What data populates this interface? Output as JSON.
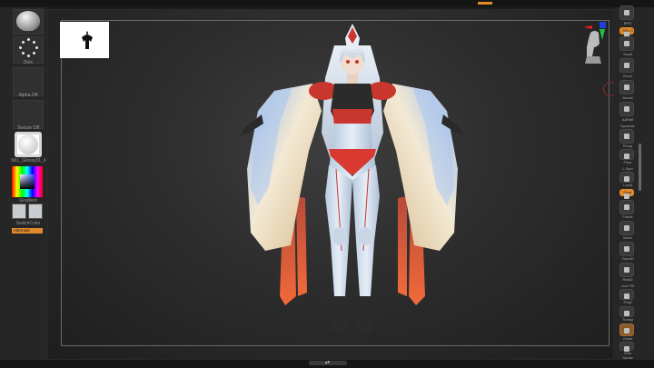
{
  "left_shelf": {
    "brush_label": "Move",
    "stroke_label": "Dots",
    "alpha_label": "Alpha Off",
    "texture_label": "Texture Off",
    "material_label": "SKL_Glossy01_4J4",
    "gradient_label": "Gradient",
    "switch_color_label": "SwitchColor",
    "alternate_label": "Alternate"
  },
  "right_shelf": {
    "items": [
      {
        "label": "BPR"
      },
      {
        "label": "SPix 3"
      },
      {
        "label": "Scroll"
      },
      {
        "label": "Zoom"
      },
      {
        "label": "Actual"
      },
      {
        "label": "AAHalf"
      },
      {
        "label": "Dynamic"
      },
      {
        "label": "Persp"
      },
      {
        "label": "Floor"
      },
      {
        "label": "L.Sym"
      },
      {
        "label": "Local"
      },
      {
        "label": "Gxyz"
      },
      {
        "label": "Frame"
      },
      {
        "label": "Move"
      },
      {
        "label": "ZoomD"
      },
      {
        "label": "RotaD"
      },
      {
        "label": "Line Fill"
      },
      {
        "label": "Polyf"
      },
      {
        "label": "Transp"
      },
      {
        "label": "Ghost"
      },
      {
        "label": "Solo"
      },
      {
        "label": "Xpose"
      }
    ]
  },
  "colors": {
    "accent": "#e08a2c",
    "background": "#1c1c1c",
    "canvas_center": "#3e3e3e"
  },
  "icons": {
    "brush": "move-brush-icon",
    "stroke": "dots-stroke-icon",
    "gizmo": "orientation-gizmo-icon",
    "head": "head-reference-icon"
  }
}
